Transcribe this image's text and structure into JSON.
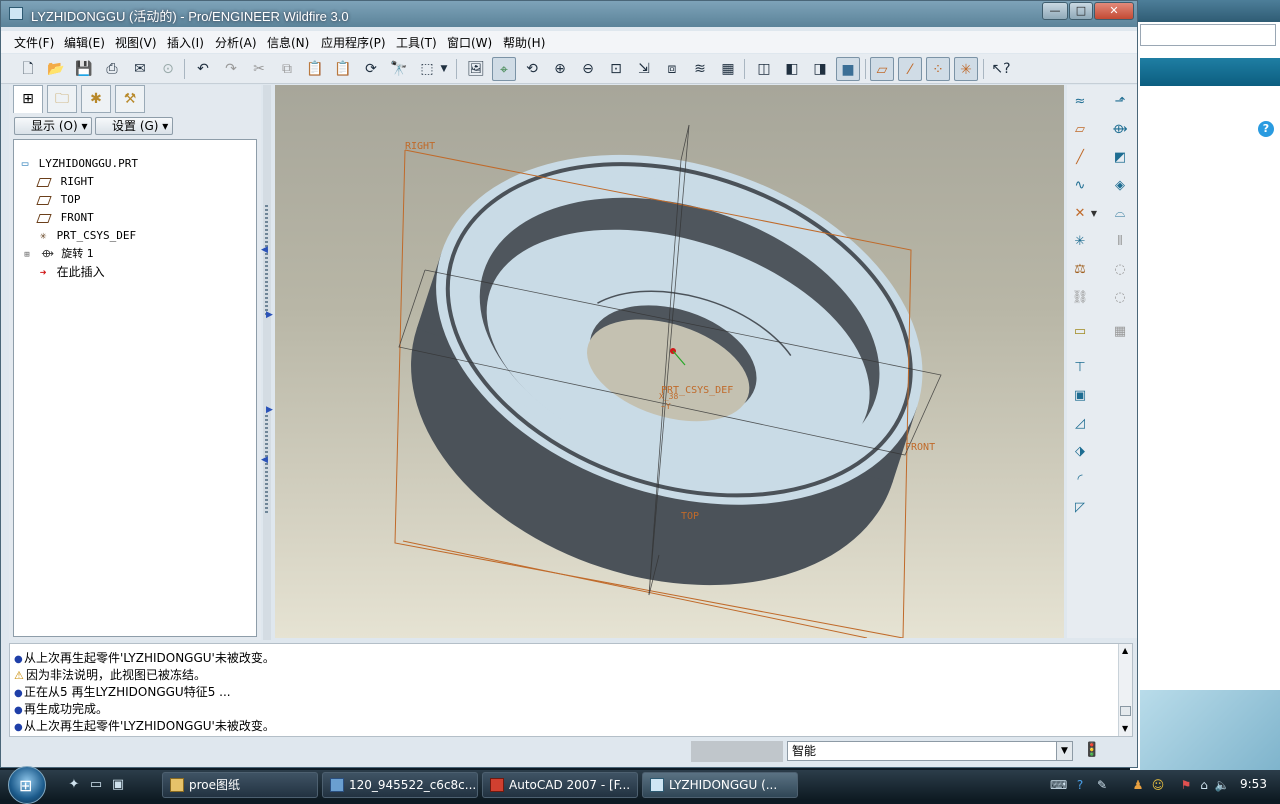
{
  "window": {
    "title": "LYZHIDONGGU (活动的) - Pro/ENGINEER Wildfire 3.0",
    "minimize": "—",
    "maximize": "□",
    "close": "✕"
  },
  "menu": [
    "文件(F)",
    "编辑(E)",
    "视图(V)",
    "插入(I)",
    "分析(A)",
    "信息(N)",
    "应用程序(P)",
    "工具(T)",
    "窗口(W)",
    "帮助(H)"
  ],
  "model_tree": {
    "display_label": "显示 (O)",
    "settings_label": "设置 (G)",
    "items": [
      {
        "label": "LYZHIDONGGU.PRT",
        "icon": "part-icon"
      },
      {
        "label": "RIGHT",
        "icon": "datum-plane-icon"
      },
      {
        "label": "TOP",
        "icon": "datum-plane-icon"
      },
      {
        "label": "FRONT",
        "icon": "datum-plane-icon"
      },
      {
        "label": "PRT_CSYS_DEF",
        "icon": "coordinate-system-icon"
      },
      {
        "label": "旋转 1",
        "icon": "revolve-icon"
      },
      {
        "label": "在此插入",
        "icon": "insert-here-arrow-icon"
      }
    ]
  },
  "graphics": {
    "datum_labels": {
      "right": "RIGHT",
      "front": "FRONT",
      "top": "TOP",
      "csys": "PRT_CSYS_DEF",
      "csys_x": "X_38",
      "csys_y": "~Y"
    },
    "model_color": "#c9dbe6",
    "model_side_color": "#4b5259",
    "datum_color": "#c06a2a"
  },
  "messages": [
    {
      "type": "info",
      "text": "从上次再生起零件'LYZHIDONGGU'未被改变。"
    },
    {
      "type": "warning",
      "text": "因为非法说明，此视图已被冻结。"
    },
    {
      "type": "info",
      "text": "正在从5 再生LYZHIDONGGU特征5 ..."
    },
    {
      "type": "info",
      "text": "再生成功完成。"
    },
    {
      "type": "info",
      "text": "从上次再生起零件'LYZHIDONGGU'未被改变。"
    }
  ],
  "status": {
    "filter_value": "智能"
  },
  "taskbar": {
    "tasks": [
      {
        "label": "proe图纸",
        "active": false
      },
      {
        "label": "120_945522_c6c8c...",
        "active": false
      },
      {
        "label": "AutoCAD 2007 - [F...",
        "active": false
      },
      {
        "label": "LYZHIDONGGU (...",
        "active": true
      }
    ],
    "clock": "9:53"
  },
  "background_window": {
    "help_icon": "?"
  }
}
